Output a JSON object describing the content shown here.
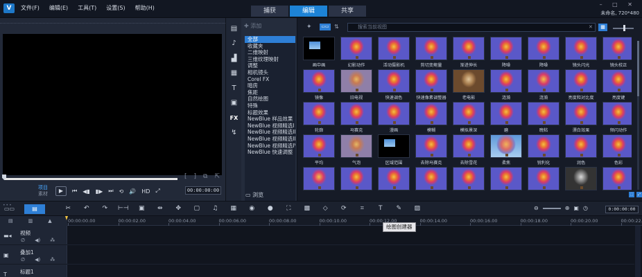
{
  "titlebar": {
    "menus": [
      "文件(F)",
      "编辑(E)",
      "工具(T)",
      "设置(S)",
      "帮助(H)"
    ],
    "modes": [
      "捕获",
      "编辑",
      "共享"
    ],
    "active_mode": "编辑",
    "project_info": "未命名, 720*480",
    "window_controls": "– □ ✕"
  },
  "preview": {
    "mode_labels": [
      "项目",
      "素材"
    ],
    "timecode": "00:00:00:00",
    "hd_label": "HD"
  },
  "folder_panel": {
    "add_label": "添加",
    "browse_label": "浏览",
    "items": [
      "全部",
      "收藏夹",
      "二维映射",
      "三维纹理映射",
      "调整",
      "相机镜头",
      "Corel FX",
      "暗房",
      "焦距",
      "自然绘图",
      "特殊",
      "标题效果",
      "NewBlue 样品效果",
      "NewBlue 视频精选I",
      "NewBlue 视频精选II",
      "NewBlue 视频精选III",
      "NewBlue 视频精选IV",
      "NewBlue 快速调整"
    ],
    "selected": "全部"
  },
  "library": {
    "view_label": "FX",
    "search_placeholder": "搜索当前视图",
    "thumbnails": [
      [
        "画中画",
        "幻影动作",
        "活动摄影机",
        "剪切变鲍量",
        "渐进伸长",
        "降噪",
        "降噪",
        "镜头闪光",
        "镜头校正"
      ],
      [
        "镜像",
        "旧电视",
        "快速调色",
        "快速像素调整器",
        "老电影",
        "涟漪",
        "涟漪",
        "亮度和对比度",
        "亮度键"
      ],
      [
        "轮廓",
        "马赛克",
        "漫画",
        "模糊",
        "模拟景深",
        "磨",
        "晚粘",
        "漂白效果",
        "频闪动作"
      ],
      [
        "平均",
        "气泡",
        "区域范围",
        "去除马赛克",
        "去除雪花",
        "柔焦",
        "锐利化",
        "润色",
        "色彩"
      ],
      [
        "",
        "",
        "",
        "",
        "",
        "",
        "",
        "",
        ""
      ]
    ]
  },
  "timeline": {
    "timecode": "0:00:00:00",
    "ruler_ticks": [
      "00:00:00.00",
      "00:00:02.00",
      "00:00:04.00",
      "00:00:06.00",
      "00:00:08.00",
      "00:00:10.00",
      "00:00:12.00",
      "00:00:14.00",
      "00:00:16.00",
      "00:00:18.00",
      "00:00:20.00",
      "00:00:22.00"
    ],
    "tracks": [
      "视频",
      "叠加1",
      "标题1"
    ],
    "tooltip": "绘图创建器"
  }
}
